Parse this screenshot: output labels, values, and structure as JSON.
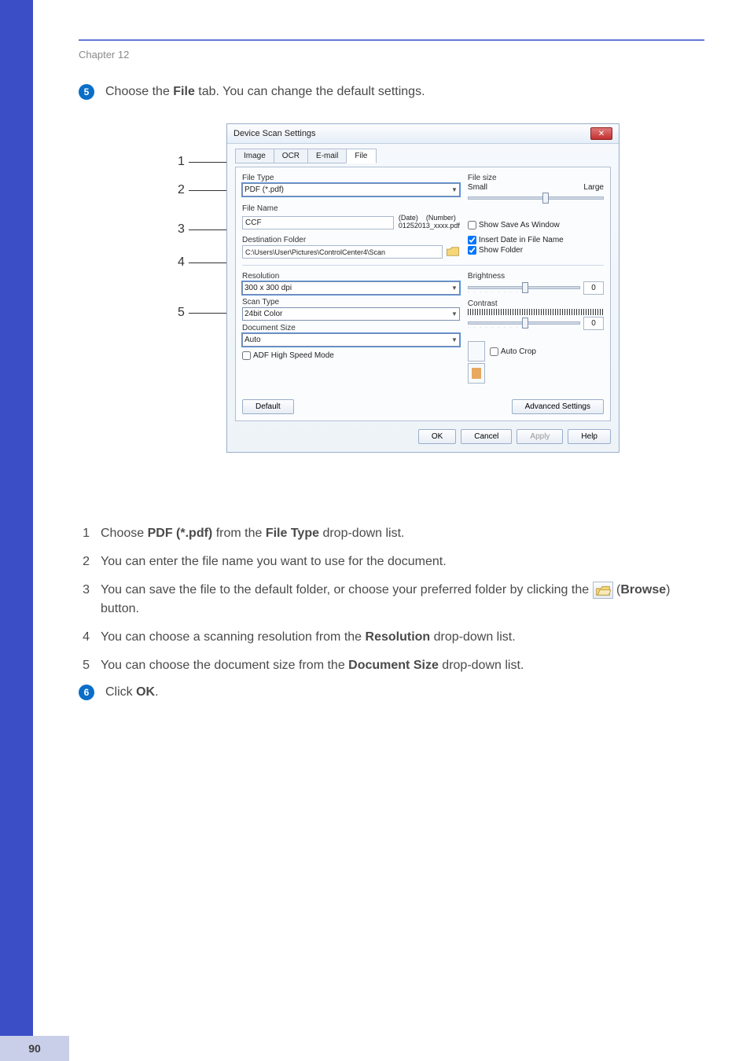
{
  "chapter": "Chapter 12",
  "step5": {
    "num": "5",
    "before": "Choose the ",
    "bold": "File",
    "after": " tab. You can change the default settings."
  },
  "dialog": {
    "title": "Device Scan Settings",
    "tabs": {
      "image": "Image",
      "ocr": "OCR",
      "email": "E-mail",
      "file": "File"
    },
    "file_type_lbl": "File Type",
    "file_type_val": "PDF (*.pdf)",
    "file_size_lbl": "File size",
    "small": "Small",
    "large": "Large",
    "file_name_lbl": "File Name",
    "file_name_val": "CCF",
    "date": "(Date)",
    "number": "(Number)",
    "date_sample": "01252013_xxxx.pdf",
    "show_save": "Show Save As Window",
    "dest_lbl": "Destination Folder",
    "dest_val": "C:\\Users\\User\\Pictures\\ControlCenter4\\Scan",
    "insert_date": "Insert Date in File Name",
    "show_folder": "Show Folder",
    "resolution_lbl": "Resolution",
    "resolution_val": "300 x 300 dpi",
    "scan_type_lbl": "Scan Type",
    "scan_type_val": "24bit Color",
    "doc_size_lbl": "Document Size",
    "doc_size_val": "Auto",
    "adf": "ADF High Speed Mode",
    "brightness": "Brightness",
    "brightness_val": "0",
    "contrast": "Contrast",
    "contrast_val": "0",
    "auto_crop": "Auto Crop",
    "default_btn": "Default",
    "adv_btn": "Advanced Settings",
    "ok": "OK",
    "cancel": "Cancel",
    "apply": "Apply",
    "help": "Help"
  },
  "callouts": {
    "1": "1",
    "2": "2",
    "3": "3",
    "4": "4",
    "5": "5"
  },
  "list": {
    "i1": {
      "n": "1",
      "before": "Choose ",
      "b1": "PDF (*.pdf)",
      "mid": " from the ",
      "b2": "File Type",
      "after": " drop-down list."
    },
    "i2": {
      "n": "2",
      "t": "You can enter the file name you want to use for the document."
    },
    "i3": {
      "n": "3",
      "t_before": "You can save the file to the default folder, or choose your preferred folder by clicking the ",
      "browse_open": "(",
      "browse": "Browse",
      "browse_close": ") button."
    },
    "i4": {
      "n": "4",
      "before": "You can choose a scanning resolution from the ",
      "b": "Resolution",
      "after": " drop-down list."
    },
    "i5": {
      "n": "5",
      "before": "You can choose the document size from the ",
      "b": "Document Size",
      "after": " drop-down list."
    }
  },
  "step6": {
    "num": "6",
    "before": "Click ",
    "bold": "OK",
    "after": "."
  },
  "page_num": "90"
}
